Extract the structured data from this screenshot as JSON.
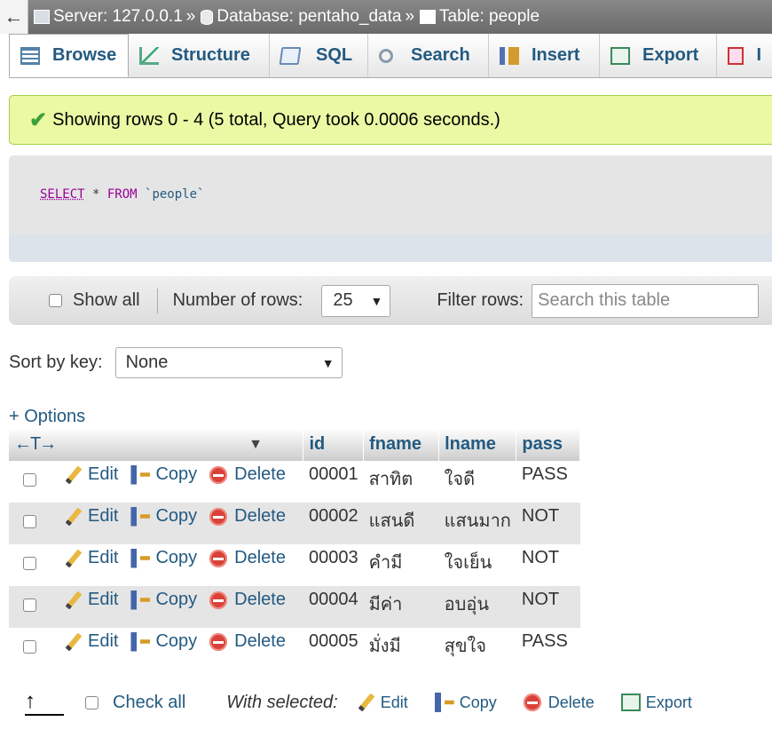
{
  "breadcrumb": {
    "back": "←",
    "server": "Server: 127.0.0.1",
    "database": "Database: pentaho_data",
    "table": "Table: people",
    "sep": "»"
  },
  "tabs": [
    {
      "label": "Browse",
      "icon": "browse-icon"
    },
    {
      "label": "Structure",
      "icon": "structure-icon"
    },
    {
      "label": "SQL",
      "icon": "sql-icon"
    },
    {
      "label": "Search",
      "icon": "search-icon"
    },
    {
      "label": "Insert",
      "icon": "insert-icon"
    },
    {
      "label": "Export",
      "icon": "export-icon"
    },
    {
      "label": "I",
      "icon": "import-icon"
    }
  ],
  "message": "Showing rows 0 - 4 (5 total, Query took 0.0006 seconds.)",
  "sql": {
    "select": "SELECT",
    "star": " * ",
    "from": "FROM",
    "table": " `people`"
  },
  "nav": {
    "show_all": "Show all",
    "number_of_rows_label": "Number of rows:",
    "number_of_rows_value": "25",
    "filter_label": "Filter rows:",
    "filter_placeholder": "Search this table"
  },
  "sort": {
    "label": "Sort by key:",
    "value": "None"
  },
  "options_link": "+ Options",
  "table": {
    "colresize": "←T→",
    "columns": [
      "id",
      "fname",
      "lname",
      "pass"
    ],
    "actions": {
      "edit": "Edit",
      "copy": "Copy",
      "delete": "Delete"
    },
    "rows": [
      {
        "id": "00001",
        "fname": "สาทิต",
        "lname": "ใจดี",
        "pass": "PASS"
      },
      {
        "id": "00002",
        "fname": "แสนดี",
        "lname": "แสนมาก",
        "pass": "NOT"
      },
      {
        "id": "00003",
        "fname": "คำมี",
        "lname": "ใจเย็น",
        "pass": "NOT"
      },
      {
        "id": "00004",
        "fname": "มีค่า",
        "lname": "อบอุ่น",
        "pass": "NOT"
      },
      {
        "id": "00005",
        "fname": "มั่งมี",
        "lname": "สุขใจ",
        "pass": "PASS"
      }
    ]
  },
  "bottom": {
    "check_all": "Check all",
    "with_selected": "With selected:",
    "edit": "Edit",
    "copy": "Copy",
    "delete": "Delete",
    "export": "Export"
  }
}
